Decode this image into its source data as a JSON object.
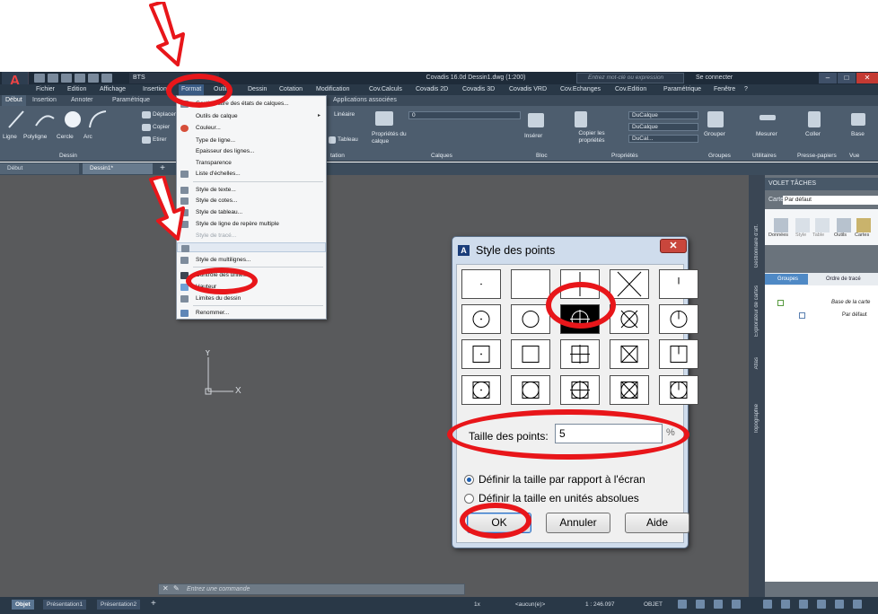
{
  "app": {
    "logo_text": "A",
    "workspace": "BTS",
    "window_title": "Covadis 16.0d   Dessin1.dwg (1:200)",
    "search_placeholder": "Entrez mot-clé ou expression",
    "sign_in": "Se connecter"
  },
  "menubar": [
    "Fichier",
    "Edition",
    "Affichage",
    "Insertion",
    "Format",
    "Outils",
    "Dessin",
    "Cotation",
    "Modification",
    "Cov.Calculs",
    "Covadis 2D",
    "Covadis 3D",
    "Covadis VRD",
    "Cov.Echanges",
    "Cov.Edition",
    "Paramétrique",
    "Fenêtre",
    "?"
  ],
  "ribbon_tabs": [
    "Début",
    "Insertion",
    "Annoter",
    "Paramétrique",
    "Applications associées"
  ],
  "ribbon": {
    "buttons": [
      "Ligne",
      "Polyligne",
      "Cercle",
      "Arc",
      "Déplacer",
      "Copier",
      "Etirer",
      "Linéaire",
      "Tableau",
      "Propriétés du calque",
      "Insérer",
      "Copier les propriétés",
      "Grouper",
      "Mesurer",
      "Coller",
      "Base"
    ],
    "dropdowns": {
      "layer": "0",
      "color": "DuCalque",
      "linetype": "DuCalque",
      "lineweight": "DuCal..."
    },
    "panels": [
      "Dessin",
      "tation",
      "Calques",
      "Bloc",
      "Propriétés",
      "Groupes",
      "Utilitaires",
      "Presse-papiers",
      "Vue"
    ]
  },
  "file_tabs": [
    "Début",
    "Dessin1*"
  ],
  "format_menu": {
    "items": [
      {
        "label": "Gestionnaire des états de calques..."
      },
      {
        "label": "Outils de calque"
      },
      {
        "label": "Couleur..."
      },
      {
        "label": "Type de ligne..."
      },
      {
        "label": "Epaisseur des lignes..."
      },
      {
        "label": "Transparence"
      },
      {
        "label": "Liste d'échelles..."
      },
      {
        "label": "Style de texte..."
      },
      {
        "label": "Style de cotes..."
      },
      {
        "label": "Style de tableau..."
      },
      {
        "label": "Style de ligne de repère multiple"
      },
      {
        "label": "Style de tracé..."
      },
      {
        "label": ""
      },
      {
        "label": "Style de multilignes..."
      },
      {
        "label": "Contrôle des unités..."
      },
      {
        "label": "Hauteur"
      },
      {
        "label": "Limites du dessin"
      },
      {
        "label": "Renommer..."
      }
    ]
  },
  "ucs": {
    "x": "X",
    "y": "Y"
  },
  "dialog": {
    "title": "Style des points",
    "size_label": "Taille des points:",
    "size_value": "5",
    "size_unit": "%",
    "radio_relative": "Définir la taille par rapport à l'écran",
    "radio_absolute": "Définir la taille en unités absolues",
    "ok": "OK",
    "cancel": "Annuler",
    "help": "Aide",
    "selected_style_index": 7
  },
  "command_line": {
    "placeholder": "Entrez une commande"
  },
  "layout_tabs": [
    "Objet",
    "Présentation1",
    "Présentation2"
  ],
  "statusbar": {
    "coords": "1x",
    "selection": "<aucun(e)>",
    "scale": "1 : 246.097",
    "mode": "OBJET"
  },
  "palette": {
    "header": "VOLET TÂCHES",
    "carte_label": "Carte:",
    "carte_value": "Par défaut",
    "tools": [
      "Données",
      "Style",
      "Table",
      "Outils",
      "Cartes"
    ],
    "tabs": [
      "Groupes",
      "Ordre de tracé"
    ],
    "tree": [
      "Base de la carte",
      "Par défaut"
    ],
    "side_labels": [
      "Gestionnaire d'aff.",
      "Explorateur de cartes",
      "Atlas",
      "Topographie"
    ]
  },
  "colors": {
    "accent_red": "#e8161a",
    "title_bar": "#1e2b39",
    "drawing_bg": "#595a5c",
    "dialog_bg": "#cfdcec"
  }
}
